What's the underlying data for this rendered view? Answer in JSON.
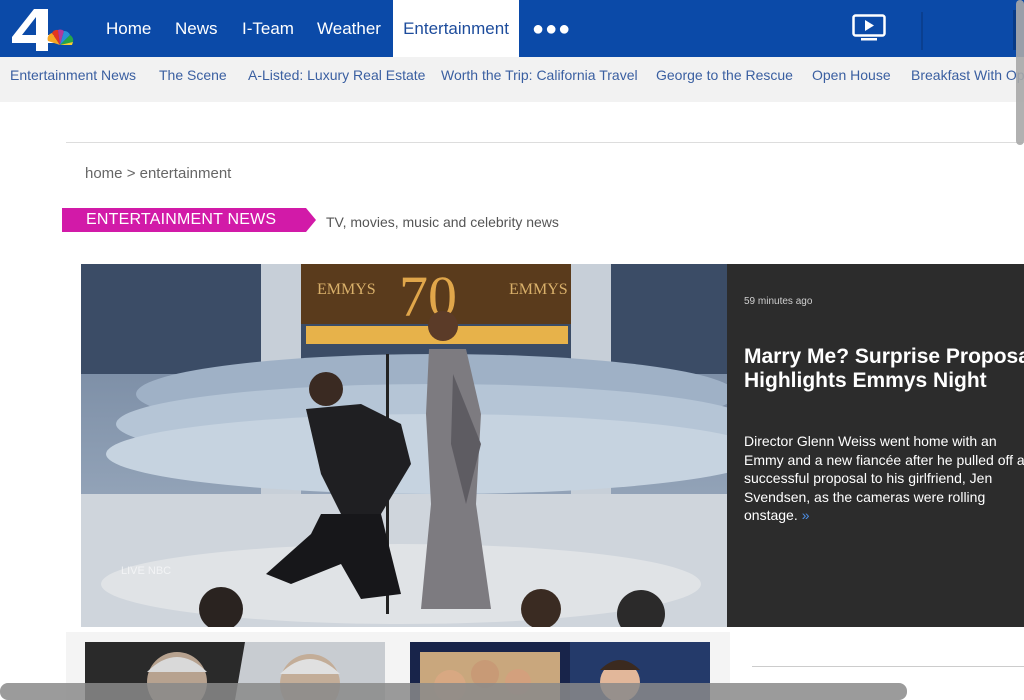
{
  "topnav": {
    "items": [
      {
        "label": "Home"
      },
      {
        "label": "News"
      },
      {
        "label": "I-Team"
      },
      {
        "label": "Weather"
      },
      {
        "label": "Entertainment",
        "active": true
      }
    ],
    "more_icon": "more-dots-icon",
    "video_icon": "tv-play-icon",
    "brand_color": "#0b4aa8"
  },
  "subnav": {
    "items": [
      {
        "label": "Entertainment News"
      },
      {
        "label": "The Scene"
      },
      {
        "label": "A-Listed: Luxury Real Estate"
      },
      {
        "label": "Worth the Trip: California Travel"
      },
      {
        "label": "George to the Rescue"
      },
      {
        "label": "Open House"
      },
      {
        "label": "Breakfast With Ope"
      }
    ]
  },
  "breadcrumb": "home > entertainment",
  "section": {
    "label": "ENTERTAINMENT NEWS",
    "subtitle": "TV, movies, music and celebrity news",
    "accent": "#d21aa8"
  },
  "hero": {
    "time": "59 minutes ago",
    "title_line1": "Marry Me? Surprise Proposal",
    "title_line2": "Highlights Emmys Night",
    "description": "Director Glenn Weiss went home with an Emmy and a new fiancée after he pulled off a successful proposal to his girlfriend, Jen Svendsen, as the cameras were rolling onstage.",
    "more_glyph": "»",
    "image_text_left": "EMMYS",
    "image_text_center": "70",
    "image_text_right": "EMMYS",
    "image_watermark": "LIVE NBC"
  }
}
